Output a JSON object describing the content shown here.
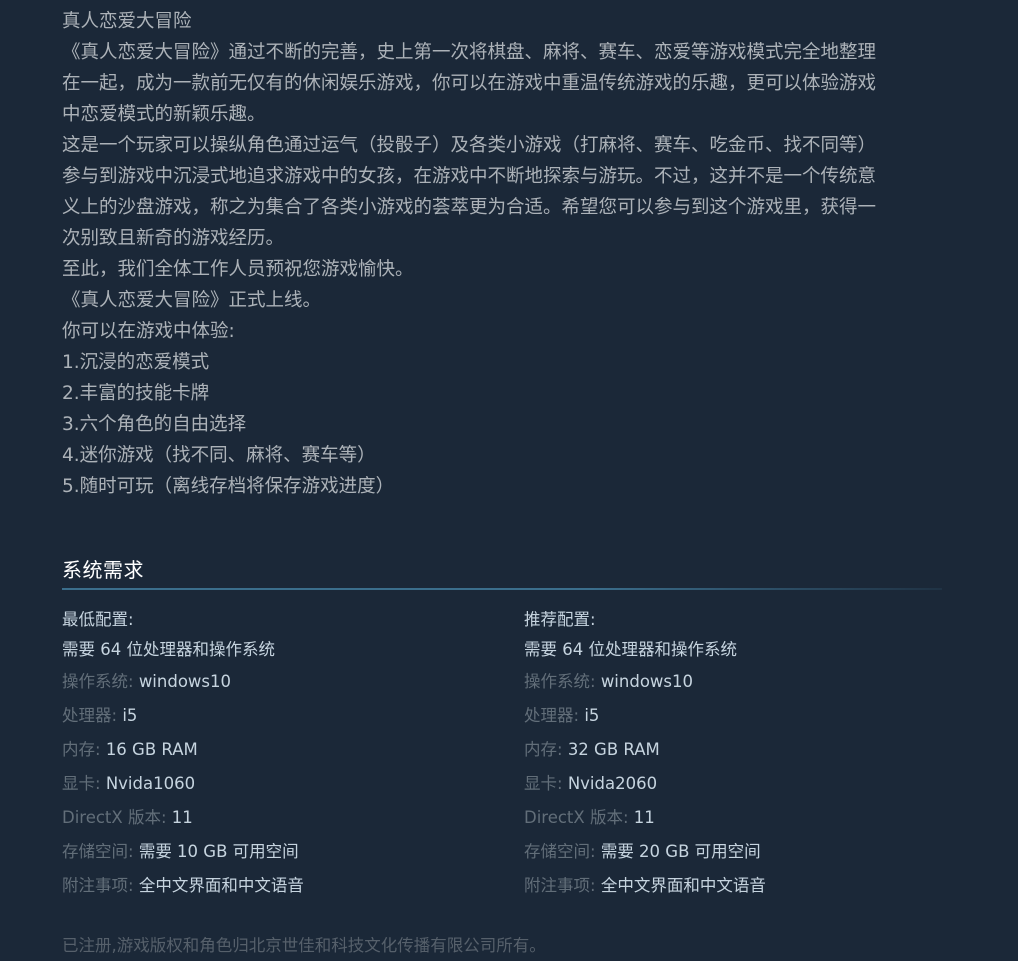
{
  "description": {
    "lines": [
      "真人恋爱大冒险",
      "《真人恋爱大冒险》通过不断的完善，史上第一次将棋盘、麻将、赛车、恋爱等游戏模式完全地整理",
      "在一起，成为一款前无仅有的休闲娱乐游戏，你可以在游戏中重温传统游戏的乐趣，更可以体验游戏",
      "中恋爱模式的新颖乐趣。",
      "这是一个玩家可以操纵角色通过运气（投骰子）及各类小游戏（打麻将、赛车、吃金币、找不同等）",
      "参与到游戏中沉浸式地追求游戏中的女孩，在游戏中不断地探索与游玩。不过，这并不是一个传统意",
      "义上的沙盘游戏，称之为集合了各类小游戏的荟萃更为合适。希望您可以参与到这个游戏里，获得一",
      "次别致且新奇的游戏经历。",
      "至此，我们全体工作人员预祝您游戏愉快。",
      "《真人恋爱大冒险》正式上线。",
      "你可以在游戏中体验:",
      "1.沉浸的恋爱模式",
      "2.丰富的技能卡牌",
      "3.六个角色的自由选择",
      "4.迷你游戏（找不同、麻将、赛车等）",
      "5.随时可玩（离线存档将保存游戏进度）"
    ]
  },
  "sysreq": {
    "title": "系统需求",
    "minimum": {
      "heading": "最低配置:",
      "note": "需要 64 位处理器和操作系统",
      "rows": [
        {
          "label": "操作系统:",
          "value": "windows10"
        },
        {
          "label": "处理器:",
          "value": "i5"
        },
        {
          "label": "内存:",
          "value": "16 GB RAM"
        },
        {
          "label": "显卡:",
          "value": "Nvida1060"
        },
        {
          "label": "DirectX 版本:",
          "value": "11"
        },
        {
          "label": "存储空间:",
          "value": "需要 10 GB 可用空间"
        },
        {
          "label": "附注事项:",
          "value": "全中文界面和中文语音"
        }
      ]
    },
    "recommended": {
      "heading": "推荐配置:",
      "note": "需要 64 位处理器和操作系统",
      "rows": [
        {
          "label": "操作系统:",
          "value": "windows10"
        },
        {
          "label": "处理器:",
          "value": "i5"
        },
        {
          "label": "内存:",
          "value": "32 GB RAM"
        },
        {
          "label": "显卡:",
          "value": "Nvida2060"
        },
        {
          "label": "DirectX 版本:",
          "value": "11"
        },
        {
          "label": "存储空间:",
          "value": "需要 20 GB 可用空间"
        },
        {
          "label": "附注事项:",
          "value": "全中文界面和中文语音"
        }
      ]
    }
  },
  "footer": {
    "text": "已注册,游戏版权和角色归北京世佳和科技文化传播有限公司所有。"
  },
  "colors": {
    "background": "#1b2838",
    "body_text": "#acb2b8",
    "label_text": "#626e79",
    "value_text": "#c6d4df",
    "divider": "#3b6e8c"
  }
}
